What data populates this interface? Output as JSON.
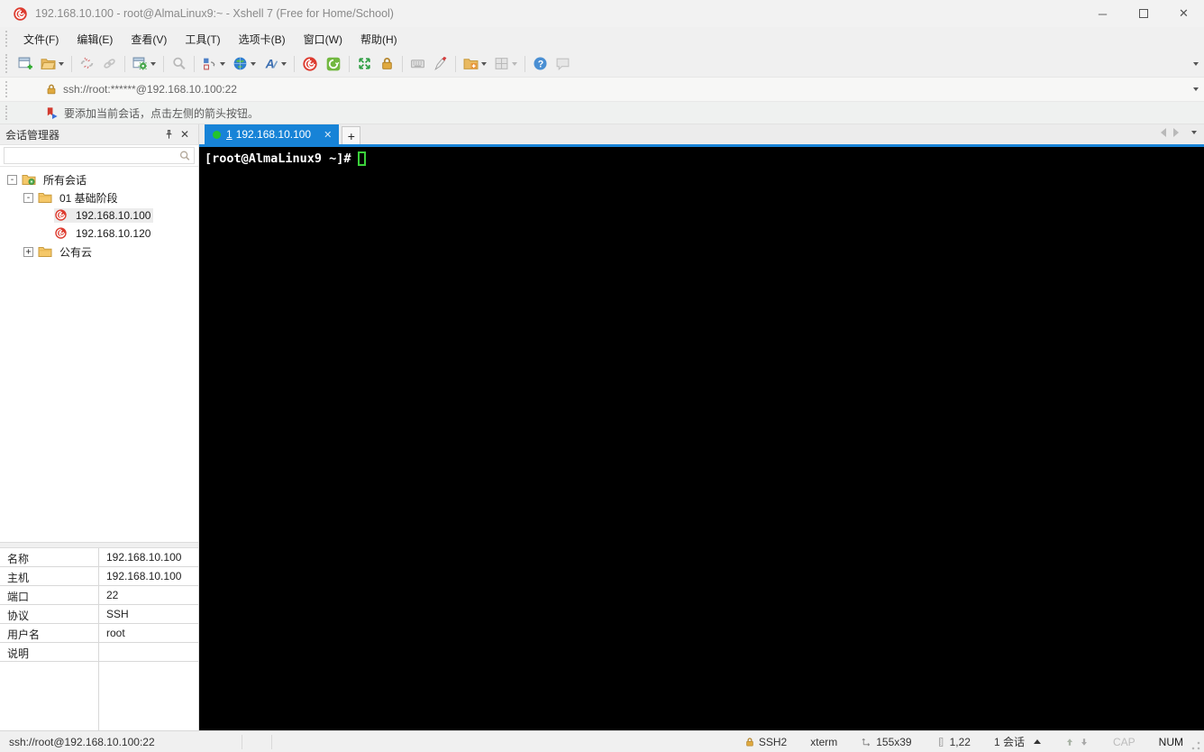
{
  "window": {
    "title": "192.168.10.100 - root@AlmaLinux9:~ - Xshell 7 (Free for Home/School)"
  },
  "menu": {
    "items": [
      {
        "name": "file",
        "label": "文件(F)"
      },
      {
        "name": "edit",
        "label": "编辑(E)"
      },
      {
        "name": "view",
        "label": "查看(V)"
      },
      {
        "name": "tools",
        "label": "工具(T)"
      },
      {
        "name": "tab",
        "label": "选项卡(B)"
      },
      {
        "name": "window",
        "label": "窗口(W)"
      },
      {
        "name": "help",
        "label": "帮助(H)"
      }
    ]
  },
  "toolbar": {
    "buttons": [
      "new-session",
      "open-folder",
      "disconnect",
      "reconnect",
      "session-properties",
      "find",
      "compose-bar",
      "web-browser",
      "font",
      "xshell",
      "xftp",
      "fullscreen",
      "lock-screen",
      "virtual-keyboard",
      "highlight-pen",
      "new-file-folder",
      "layout",
      "help",
      "feedback"
    ]
  },
  "address": {
    "value": "ssh://root:******@192.168.10.100:22"
  },
  "notice": {
    "text": "要添加当前会话，点击左侧的箭头按钮。"
  },
  "session_manager": {
    "title": "会话管理器",
    "tree": [
      {
        "name": "all-sessions",
        "label": "所有会话",
        "type": "root",
        "level": 0,
        "expanded": true
      },
      {
        "name": "group-01-base",
        "label": "01 基础阶段",
        "type": "folder",
        "level": 1,
        "expanded": true
      },
      {
        "name": "session-100",
        "label": "192.168.10.100",
        "type": "session",
        "level": 2,
        "selected": true
      },
      {
        "name": "session-120",
        "label": "192.168.10.120",
        "type": "session",
        "level": 2
      },
      {
        "name": "public-cloud",
        "label": "公有云",
        "type": "folder",
        "level": 1,
        "expanded": false
      }
    ],
    "properties": [
      {
        "key": "名称",
        "value": "192.168.10.100"
      },
      {
        "key": "主机",
        "value": "192.168.10.100"
      },
      {
        "key": "端口",
        "value": "22"
      },
      {
        "key": "协议",
        "value": "SSH"
      },
      {
        "key": "用户名",
        "value": "root"
      },
      {
        "key": "说明",
        "value": ""
      }
    ]
  },
  "tabs": {
    "active": {
      "index": "1",
      "label": "192.168.10.100",
      "close": "✕"
    },
    "new_tab": "+"
  },
  "terminal": {
    "prompt": "[root@AlmaLinux9 ~]#"
  },
  "status": {
    "left": "ssh://root@192.168.10.100:22",
    "encryption": "SSH2",
    "terminal_type": "xterm",
    "size": "155x39",
    "cursor_position": "1,22",
    "sessions": "1 会话",
    "cap": "CAP",
    "num": "NUM"
  },
  "colors": {
    "accent": "#1783d7",
    "tab_dot": "#23c32e",
    "terminal_cursor": "#3bd13b",
    "terminal_bg": "#000000"
  }
}
